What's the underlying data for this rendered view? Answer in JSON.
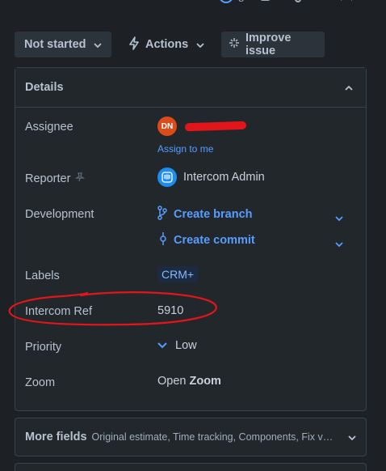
{
  "toolbar": {
    "watch_count": "8",
    "icons": [
      "eye-icon",
      "copy-icon",
      "share-icon",
      "more-icon",
      "close-icon"
    ]
  },
  "actions": {
    "status_label": "Not started",
    "actions_label": "Actions",
    "improve_label": "Improve issue"
  },
  "details": {
    "title": "Details",
    "assignee": {
      "label": "Assignee",
      "initials": "DN",
      "assign_to_me": "Assign to me"
    },
    "reporter": {
      "label": "Reporter",
      "name": "Intercom Admin"
    },
    "development": {
      "label": "Development",
      "create_branch": "Create branch",
      "create_commit": "Create commit"
    },
    "labels": {
      "label": "Labels",
      "value": "CRM+"
    },
    "intercom_ref": {
      "label": "Intercom Ref",
      "value": "5910"
    },
    "priority": {
      "label": "Priority",
      "value": "Low"
    },
    "zoom": {
      "label": "Zoom",
      "value_prefix": "Open",
      "value_bold": "Zoom"
    }
  },
  "more_fields": {
    "title": "More fields",
    "subtitle": "Original estimate, Time tracking, Components, Fix versions"
  },
  "colors": {
    "background": "#1d2125",
    "panel": "#22272b",
    "link": "#579dff",
    "annotation": "#e0161b",
    "avatar": "#dc4b1a"
  }
}
